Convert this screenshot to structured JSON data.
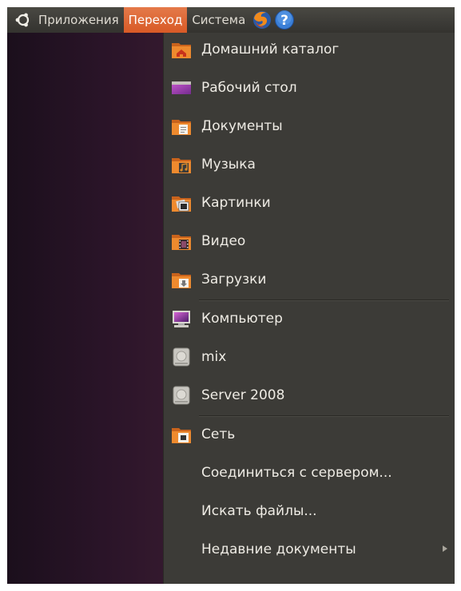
{
  "panel": {
    "menus": [
      "Приложения",
      "Переход",
      "Система"
    ],
    "active_menu": "Переход",
    "icons": [
      "ubuntu-logo-icon",
      "firefox-icon",
      "help-icon"
    ]
  },
  "places_menu": {
    "items": [
      {
        "label": "Домашний каталог",
        "icon": "home-folder-icon"
      },
      {
        "label": "Рабочий стол",
        "icon": "desktop-icon"
      },
      {
        "label": "Документы",
        "icon": "documents-folder-icon"
      },
      {
        "label": "Музыка",
        "icon": "music-folder-icon"
      },
      {
        "label": "Картинки",
        "icon": "pictures-folder-icon"
      },
      {
        "label": "Видео",
        "icon": "videos-folder-icon"
      },
      {
        "label": "Загрузки",
        "icon": "downloads-folder-icon"
      },
      {
        "label": "Компьютер",
        "icon": "computer-icon"
      },
      {
        "label": "mix",
        "icon": "drive-icon"
      },
      {
        "label": "Server 2008",
        "icon": "drive-icon"
      },
      {
        "label": "Сеть",
        "icon": "network-folder-icon"
      },
      {
        "label": "Соединиться с сервером...",
        "icon": ""
      },
      {
        "label": "Искать файлы...",
        "icon": ""
      },
      {
        "label": "Недавние документы",
        "icon": "",
        "submenu": true
      }
    ]
  },
  "colors": {
    "panel": "#3c3b37",
    "active": "#dd6a35",
    "menu_bg": "#3c3b37",
    "folder": "#e8882c"
  }
}
